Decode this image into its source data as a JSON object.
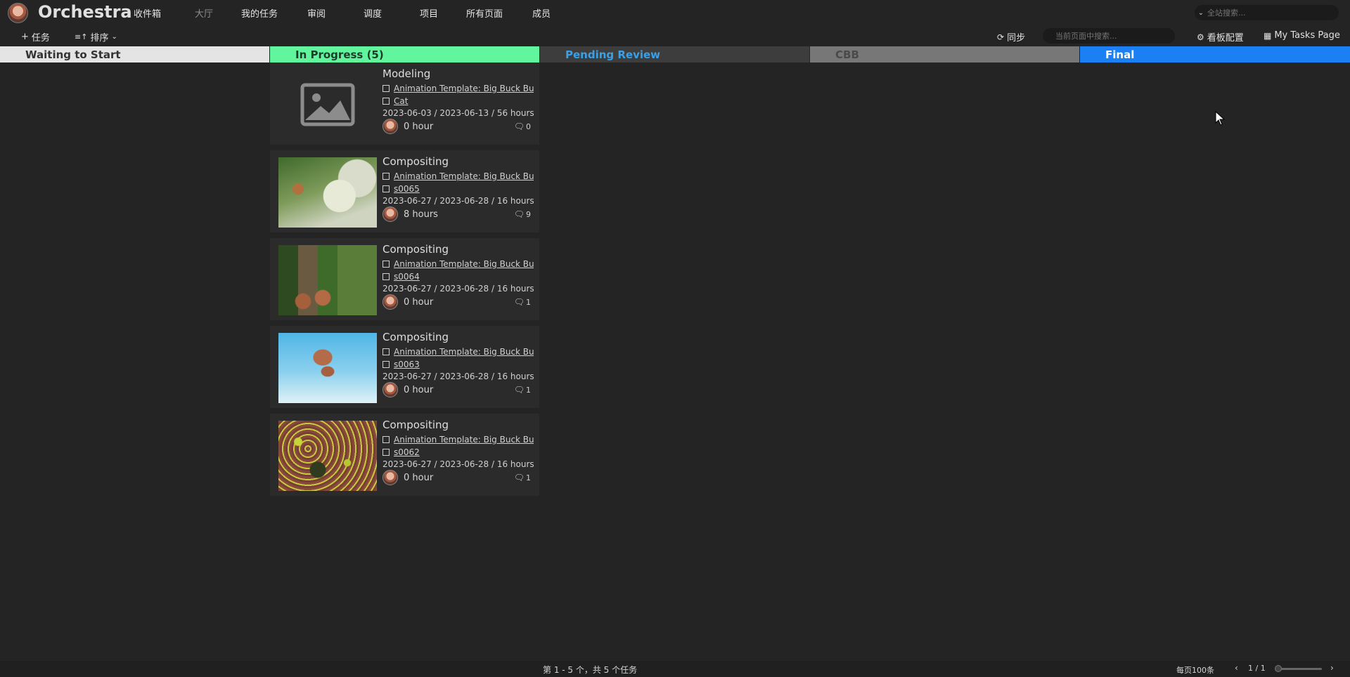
{
  "app": {
    "brand": "Orchestra"
  },
  "nav": [
    "收件箱",
    "大厅",
    "我的任务",
    "审阅",
    "调度",
    "项目",
    "所有页面",
    "成员"
  ],
  "global_search": {
    "placeholder": "全站搜索..."
  },
  "toolbar": {
    "add_task": "任务",
    "sort": "排序",
    "sync": "同步",
    "page_search_placeholder": "当前页面中搜索...",
    "board_config": "看板配置",
    "my_tasks": "My Tasks Page"
  },
  "columns": [
    {
      "label": "Waiting to Start",
      "bg": "#e4e4e4",
      "fg": "#333333"
    },
    {
      "label": "In Progress (5)",
      "bg": "#61f59e",
      "fg": "#1e3b2a"
    },
    {
      "label": "Pending Review",
      "bg": "#3d3d3d",
      "fg": "#3aa0e8"
    },
    {
      "label": "CBB",
      "bg": "#777777",
      "fg": "#4a4a4a"
    },
    {
      "label": "Final",
      "bg": "#1b80f3",
      "fg": "#ffffff"
    }
  ],
  "cards": [
    {
      "title": "Modeling",
      "project": "Animation Template: Big Buck Bunny",
      "entity": "Cat",
      "dates": "2023-06-03 / 2023-06-13 / 56 hours",
      "hours": "0 hour",
      "comments": "0",
      "thumb": "placeholder"
    },
    {
      "title": "Compositing",
      "project": "Animation Template: Big Buck Bunny",
      "entity": "s0065",
      "dates": "2023-06-27 / 2023-06-28 / 16 hours",
      "hours": "8 hours",
      "comments": "9",
      "thumb": "bunny"
    },
    {
      "title": "Compositing",
      "project": "Animation Template: Big Buck Bunny",
      "entity": "s0064",
      "dates": "2023-06-27 / 2023-06-28 / 16 hours",
      "hours": "0 hour",
      "comments": "1",
      "thumb": "forest"
    },
    {
      "title": "Compositing",
      "project": "Animation Template: Big Buck Bunny",
      "entity": "s0063",
      "dates": "2023-06-27 / 2023-06-28 / 16 hours",
      "hours": "0 hour",
      "comments": "1",
      "thumb": "sky"
    },
    {
      "title": "Compositing",
      "project": "Animation Template: Big Buck Bunny",
      "entity": "s0062",
      "dates": "2023-06-27 / 2023-06-28 / 16 hours",
      "hours": "0 hour",
      "comments": "1",
      "thumb": "leaves"
    }
  ],
  "footer": {
    "summary": "第 1 - 5 个，共 5 个任务",
    "per_page": "每页100条",
    "pages": "1 / 1"
  }
}
